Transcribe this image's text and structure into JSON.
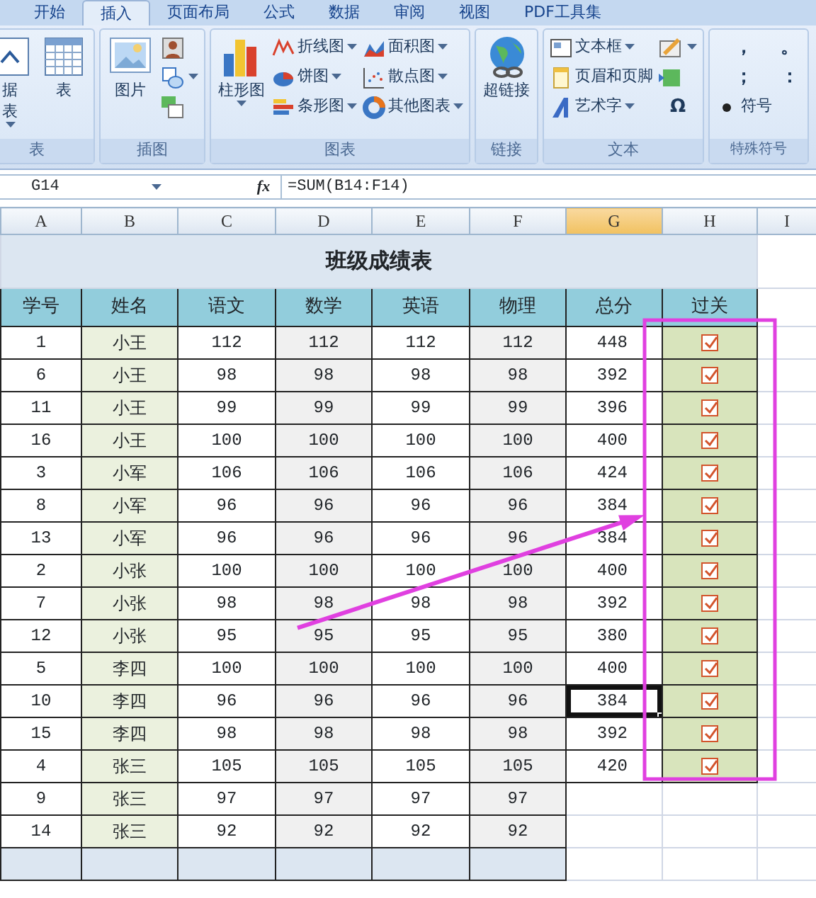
{
  "ribbon_tabs": [
    {
      "label": "开始",
      "selected": false
    },
    {
      "label": "插入",
      "selected": true
    },
    {
      "label": "页面布局",
      "selected": false
    },
    {
      "label": "公式",
      "selected": false
    },
    {
      "label": "数据",
      "selected": false
    },
    {
      "label": "审阅",
      "selected": false
    },
    {
      "label": "视图",
      "selected": false
    },
    {
      "label": "PDF工具集",
      "selected": false
    }
  ],
  "ribbon_groups": [
    {
      "label": "表",
      "items": [
        {
          "kind": "large",
          "lines": [
            "据",
            "表"
          ],
          "dropdown": true
        },
        {
          "kind": "large",
          "lines": [
            "表"
          ],
          "dropdown": false
        }
      ]
    },
    {
      "label": "插图",
      "items": [
        {
          "kind": "large",
          "lines": [
            "图片"
          ],
          "dropdown": false
        },
        {
          "kind": "icon",
          "dropdown": false
        },
        {
          "kind": "icon",
          "dropdown": true
        },
        {
          "kind": "icon",
          "dropdown": false
        }
      ]
    },
    {
      "label": "图表",
      "items": [
        {
          "kind": "large",
          "lines": [
            "柱形图"
          ],
          "dropdown": true
        },
        {
          "kind": "small",
          "label": "折线图",
          "dropdown": true
        },
        {
          "kind": "small",
          "label": "饼图",
          "dropdown": true
        },
        {
          "kind": "small",
          "label": "条形图",
          "dropdown": true
        },
        {
          "kind": "small",
          "label": "面积图",
          "dropdown": true
        },
        {
          "kind": "small",
          "label": "散点图",
          "dropdown": true
        },
        {
          "kind": "small",
          "label": "其他图表",
          "dropdown": true
        }
      ]
    },
    {
      "label": "链接",
      "items": [
        {
          "kind": "large",
          "lines": [
            "超链接"
          ],
          "dropdown": false
        }
      ]
    },
    {
      "label": "文本",
      "items": [
        {
          "kind": "small",
          "label": "文本框",
          "dropdown": true
        },
        {
          "kind": "small",
          "label": "页眉和页脚",
          "dropdown": false
        },
        {
          "kind": "small",
          "label": "艺术字",
          "dropdown": true
        },
        {
          "kind": "icon",
          "dropdown": true
        },
        {
          "kind": "icon",
          "dropdown": false
        },
        {
          "kind": "symbol",
          "label": "Ω",
          "dropdown": false
        }
      ]
    },
    {
      "label": "特殊符号",
      "items": [
        {
          "kind": "symbol",
          "label": "，",
          "dropdown": false
        },
        {
          "kind": "symbol",
          "label": "；",
          "dropdown": false
        },
        {
          "kind": "small",
          "label": "符号",
          "dropdown": false
        },
        {
          "kind": "symbol",
          "label": "。",
          "dropdown": false
        },
        {
          "kind": "symbol",
          "label": "：",
          "dropdown": false
        }
      ]
    }
  ],
  "formula_bar": {
    "name_box": "G14",
    "fx": "fx",
    "formula": "=SUM(B14:F14)"
  },
  "column_headers": [
    {
      "label": "A",
      "selected": false
    },
    {
      "label": "B",
      "selected": false
    },
    {
      "label": "C",
      "selected": false
    },
    {
      "label": "D",
      "selected": false
    },
    {
      "label": "E",
      "selected": false
    },
    {
      "label": "F",
      "selected": false
    },
    {
      "label": "G",
      "selected": true
    },
    {
      "label": "H",
      "selected": false
    },
    {
      "label": "I",
      "selected": false
    }
  ],
  "sheet_title": "班级成绩表",
  "table_headers": [
    "学号",
    "姓名",
    "语文",
    "数学",
    "英语",
    "物理",
    "总分",
    "过关"
  ],
  "rows": [
    {
      "cells": [
        "1",
        "小王",
        "112",
        "112",
        "112",
        "112",
        "448"
      ],
      "passed": true,
      "selected": false
    },
    {
      "cells": [
        "6",
        "小王",
        "98",
        "98",
        "98",
        "98",
        "392"
      ],
      "passed": true,
      "selected": false
    },
    {
      "cells": [
        "11",
        "小王",
        "99",
        "99",
        "99",
        "99",
        "396"
      ],
      "passed": true,
      "selected": false
    },
    {
      "cells": [
        "16",
        "小王",
        "100",
        "100",
        "100",
        "100",
        "400"
      ],
      "passed": true,
      "selected": false
    },
    {
      "cells": [
        "3",
        "小军",
        "106",
        "106",
        "106",
        "106",
        "424"
      ],
      "passed": true,
      "selected": false
    },
    {
      "cells": [
        "8",
        "小军",
        "96",
        "96",
        "96",
        "96",
        "384"
      ],
      "passed": true,
      "selected": false
    },
    {
      "cells": [
        "13",
        "小军",
        "96",
        "96",
        "96",
        "96",
        "384"
      ],
      "passed": true,
      "selected": false
    },
    {
      "cells": [
        "2",
        "小张",
        "100",
        "100",
        "100",
        "100",
        "400"
      ],
      "passed": true,
      "selected": false
    },
    {
      "cells": [
        "7",
        "小张",
        "98",
        "98",
        "98",
        "98",
        "392"
      ],
      "passed": true,
      "selected": false
    },
    {
      "cells": [
        "12",
        "小张",
        "95",
        "95",
        "95",
        "95",
        "380"
      ],
      "passed": true,
      "selected": false
    },
    {
      "cells": [
        "5",
        "李四",
        "100",
        "100",
        "100",
        "100",
        "400"
      ],
      "passed": true,
      "selected": false
    },
    {
      "cells": [
        "10",
        "李四",
        "96",
        "96",
        "96",
        "96",
        "384"
      ],
      "passed": true,
      "selected": true
    },
    {
      "cells": [
        "15",
        "李四",
        "98",
        "98",
        "98",
        "98",
        "392"
      ],
      "passed": true,
      "selected": false
    },
    {
      "cells": [
        "4",
        "张三",
        "105",
        "105",
        "105",
        "105",
        "420"
      ],
      "passed": true,
      "selected": false
    },
    {
      "cells": [
        "9",
        "张三",
        "97",
        "97",
        "97",
        "97"
      ],
      "passed": false,
      "selected": false
    },
    {
      "cells": [
        "14",
        "张三",
        "92",
        "92",
        "92",
        "92"
      ],
      "passed": false,
      "selected": false
    }
  ],
  "highlight_frame": {
    "color": "#e040e0"
  },
  "annotation_arrow": {
    "color": "#e040e0"
  }
}
